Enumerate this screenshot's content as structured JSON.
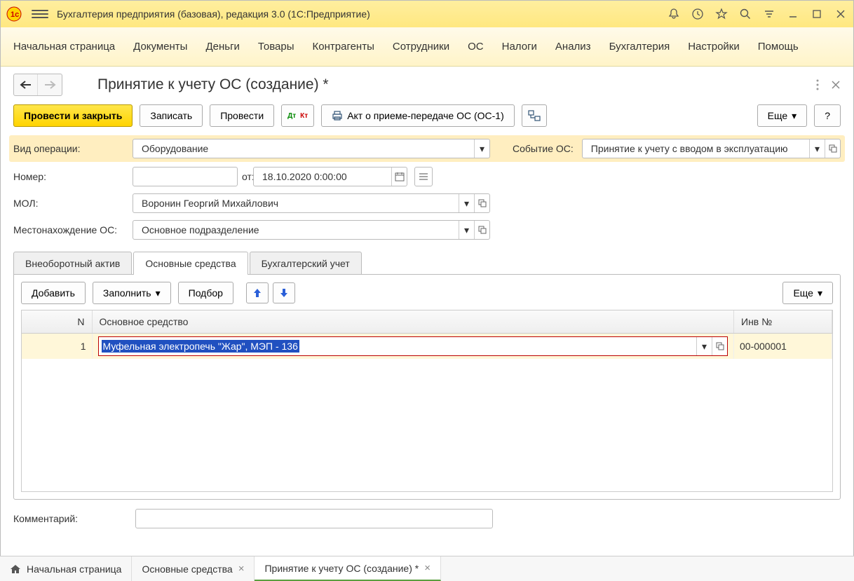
{
  "title": "Бухгалтерия предприятия (базовая), редакция 3.0  (1С:Предприятие)",
  "menu": [
    "Начальная страница",
    "Документы",
    "Деньги",
    "Товары",
    "Контрагенты",
    "Сотрудники",
    "ОС",
    "Налоги",
    "Анализ",
    "Бухгалтерия",
    "Настройки",
    "Помощь"
  ],
  "page_title": "Принятие к учету ОС (создание) *",
  "toolbar": {
    "post_close": "Провести и закрыть",
    "save": "Записать",
    "post": "Провести",
    "print_doc": "Акт о приеме-передаче ОС (ОС-1)",
    "more": "Еще",
    "help": "?"
  },
  "fields": {
    "operation_label": "Вид операции:",
    "operation_value": "Оборудование",
    "event_label": "Событие ОС:",
    "event_value": "Принятие к учету с вводом в эксплуатацию",
    "number_label": "Номер:",
    "number_value": "",
    "date_label": "от:",
    "date_value": "18.10.2020  0:00:00",
    "mol_label": "МОЛ:",
    "mol_value": "Воронин Георгий Михайлович",
    "location_label": "Местонахождение ОС:",
    "location_value": "Основное подразделение"
  },
  "tabs": [
    "Внеоборотный актив",
    "Основные средства",
    "Бухгалтерский учет"
  ],
  "tab_toolbar": {
    "add": "Добавить",
    "fill": "Заполнить",
    "select": "Подбор",
    "more": "Еще"
  },
  "table": {
    "headers": {
      "n": "N",
      "asset": "Основное средство",
      "inv": "Инв №"
    },
    "rows": [
      {
        "n": "1",
        "asset": "Муфельная электропечь \"Жар\", МЭП - 136",
        "inv": "00-000001"
      }
    ]
  },
  "comment_label": "Комментарий:",
  "comment_value": "",
  "bottom_tabs": {
    "home": "Начальная страница",
    "t1": "Основные средства",
    "t2": "Принятие к учету ОС (создание) *"
  }
}
